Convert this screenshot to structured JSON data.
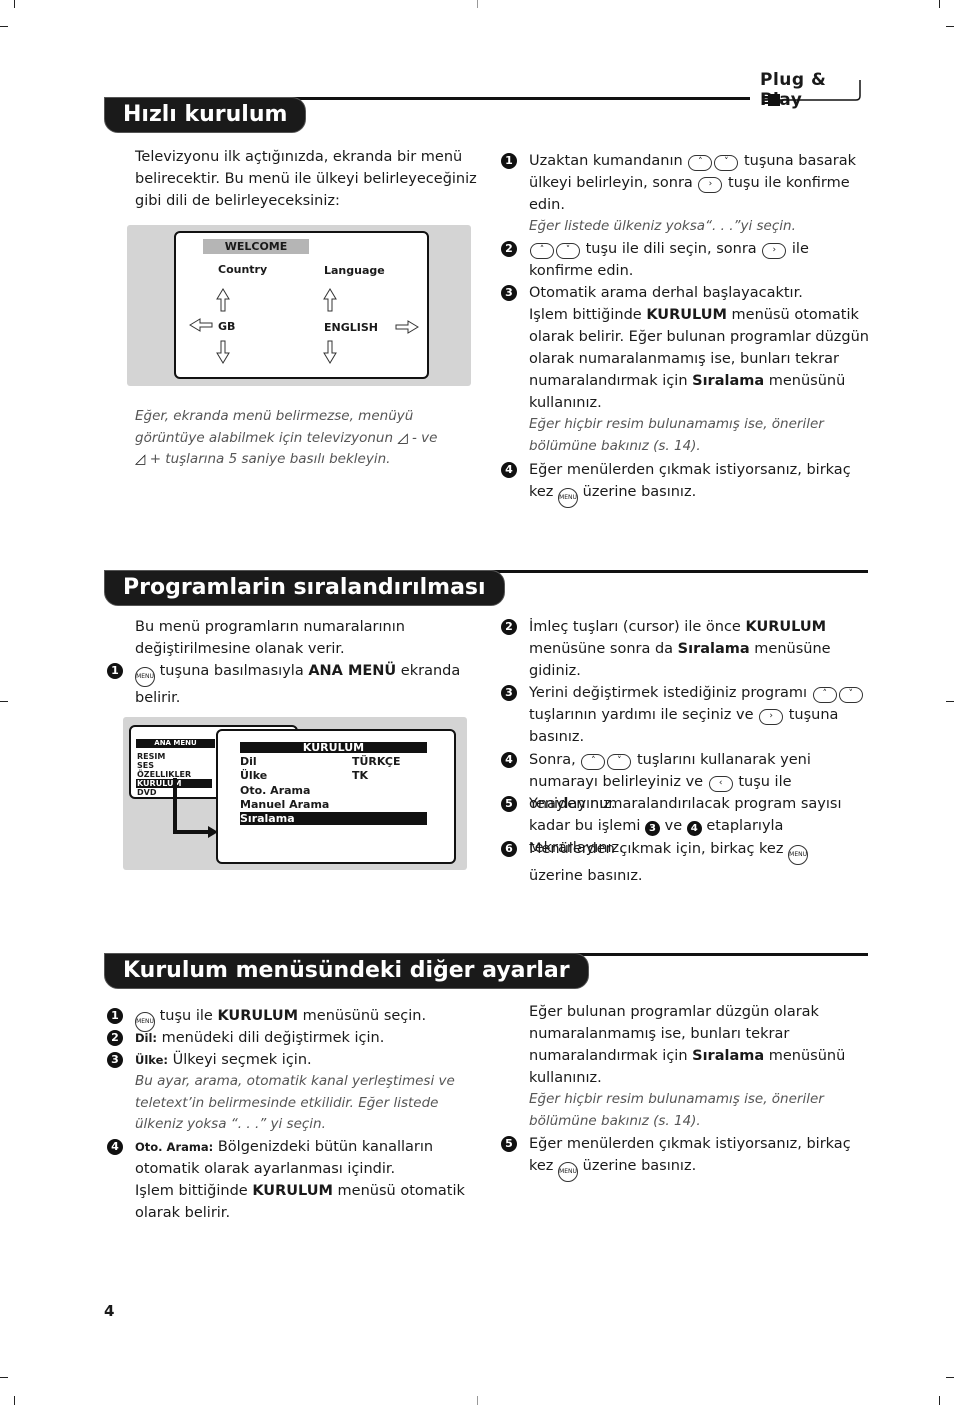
{
  "brand": {
    "logo_text": "Plug & Play"
  },
  "page_number": "4",
  "sections": {
    "quick_setup": {
      "title": "Hızlı kurulum",
      "intro": "Televizyonu ilk açtığınızda, ekranda bir menü belirecektir. Bu menü ile ülkeyi belirleyeceğiniz gibi dili de belirleyeceksiniz:",
      "tv_screen": {
        "header": "WELCOME",
        "country_label": "Country",
        "country_value": "GB",
        "language_label": "Language",
        "language_value": "ENGLISH"
      },
      "note": "Eğer, ekranda menü belirmezse, menüyü görüntüye alabilmek için televizyonun ◿ - ve ◿ + tuşlarına 5 saniye basılı bekleyin.",
      "note_parts": {
        "a": "Eğer, ekranda menü belirmezse, menüyü görüntüye alabilmek için televizyonun",
        "b": "- ve",
        "c": "+ tuşlarına 5 saniye basılı bekleyin."
      },
      "steps": [
        {
          "num": "1",
          "a": "Uzaktan kumandanın",
          "b": "tuşuna basarak ülkeyi belirleyin, sonra",
          "c": "tuşu ile konfirme edin.",
          "note": "Eğer listede ülkeniz yoksa“. . .”yi seçin."
        },
        {
          "num": "2",
          "a": "tuşu ile dili seçin, sonra",
          "b": "ile konfirme edin."
        },
        {
          "num": "3",
          "a": "Otomatik arama derhal başlayacaktır.",
          "b": "Işlem bittiğinde",
          "bold1": "KURULUM",
          "c": "menüsü otomatik olarak belirir. Eğer bulunan programlar düzgün olarak numaralanmamış ise, bunları tekrar numaralandırmak için",
          "bold2": "Sıralama",
          "d": "menüsünü kullanınız.",
          "note": "Eğer hiçbir resim bulunamamış ise, öneriler bölümüne bakınız (s. 14)."
        },
        {
          "num": "4",
          "a": "Eğer menülerden çıkmak istiyorsanız, birkaç kez",
          "b": "üzerine basınız."
        }
      ]
    },
    "program_sort": {
      "title": "Programlarin sıralandırılması",
      "intro": "Bu menü programların numaralarının değiştirilmesine olanak verir.",
      "tv_screen": {
        "main_menu_title": "ANA MENÜ",
        "main_menu_items": [
          "RESIM",
          "SES",
          "ÖZELLIKLER",
          "KURULUM",
          "DVD"
        ],
        "main_menu_selected": "KURULUM",
        "submenu_title": "KURULUM",
        "submenu_items": [
          {
            "label": "Dil",
            "value": "TÜRKÇE"
          },
          {
            "label": "Ülke",
            "value": "TK"
          },
          {
            "label": "Oto. Arama",
            "value": ""
          },
          {
            "label": "Manuel Arama",
            "value": ""
          },
          {
            "label": "Sıralama",
            "value": ""
          }
        ],
        "submenu_selected": "Sıralama"
      },
      "steps": [
        {
          "num": "1",
          "a": "tuşuna basılmasıyla",
          "bold1": "ANA MENÜ",
          "b": "ekranda belirir."
        },
        {
          "num": "2",
          "a": "İmleç tuşları (cursor) ile önce",
          "bold1": "KURULUM",
          "b": "menüsüne sonra da",
          "bold2": "Sıralama",
          "c": "menüsüne gidiniz."
        },
        {
          "num": "3",
          "a": "Yerini değiştirmek istediğiniz programı",
          "b": "tuşlarının yardımı ile seçiniz ve",
          "c": "tuşuna basınız."
        },
        {
          "num": "4",
          "a": "Sonra,",
          "b": "tuşlarını kullanarak yeni numarayı belirleyiniz ve",
          "c": "tuşu ile onaylayınız."
        },
        {
          "num": "5",
          "a": "Yeniden numaralandırılacak program sayısı kadar bu işlemi",
          "ref1": "3",
          "b": "ve",
          "ref2": "4",
          "c": "etaplarıyla tekrarlayınız."
        },
        {
          "num": "6",
          "a": "Menülerden çıkmak için, birkaç kez",
          "b": "üzerine basınız."
        }
      ]
    },
    "other_settings": {
      "title": "Kurulum menüsündeki diğer ayarlar",
      "steps": [
        {
          "num": "1",
          "a": "tuşu ile",
          "bold1": "KURULUM",
          "b": "menüsünü seçin."
        },
        {
          "num": "2",
          "label": "Dil:",
          "a": "menüdeki dili değiştirmek için."
        },
        {
          "num": "3",
          "label": "Ülke:",
          "a": "Ülkeyi seçmek için.",
          "note": "Bu ayar, arama, otomatik kanal yerleştimesi ve teletext’in belirmesinde etkilidir. Eğer listede ülkeniz yoksa “. . .” yi seçin."
        },
        {
          "num": "4",
          "label": "Oto. Arama:",
          "a": "Bölgenizdeki bütün kanalların otomatik olarak ayarlanması içindir.",
          "b": "Işlem bittiğinde",
          "bold1": "KURULUM",
          "c": "menüsü otomatik olarak belirir."
        }
      ],
      "right_text": {
        "a": "Eğer bulunan programlar düzgün olarak numaralanmamış ise, bunları tekrar numaralandırmak için",
        "bold1": "Sıralama",
        "b": "menüsünü kullanınız.",
        "note": "Eğer hiçbir resim bulunamamış ise, öneriler bölümüne bakınız (s. 14)."
      },
      "step5": {
        "num": "5",
        "a": "Eğer menülerden çıkmak istiyorsanız, birkaç kez",
        "b": "üzerine basınız."
      }
    }
  },
  "icons": {
    "up_key": "˄",
    "down_key": "˅",
    "right_key": "›",
    "left_key": "‹",
    "menu_key": "MENU",
    "volume_key": "◿"
  }
}
